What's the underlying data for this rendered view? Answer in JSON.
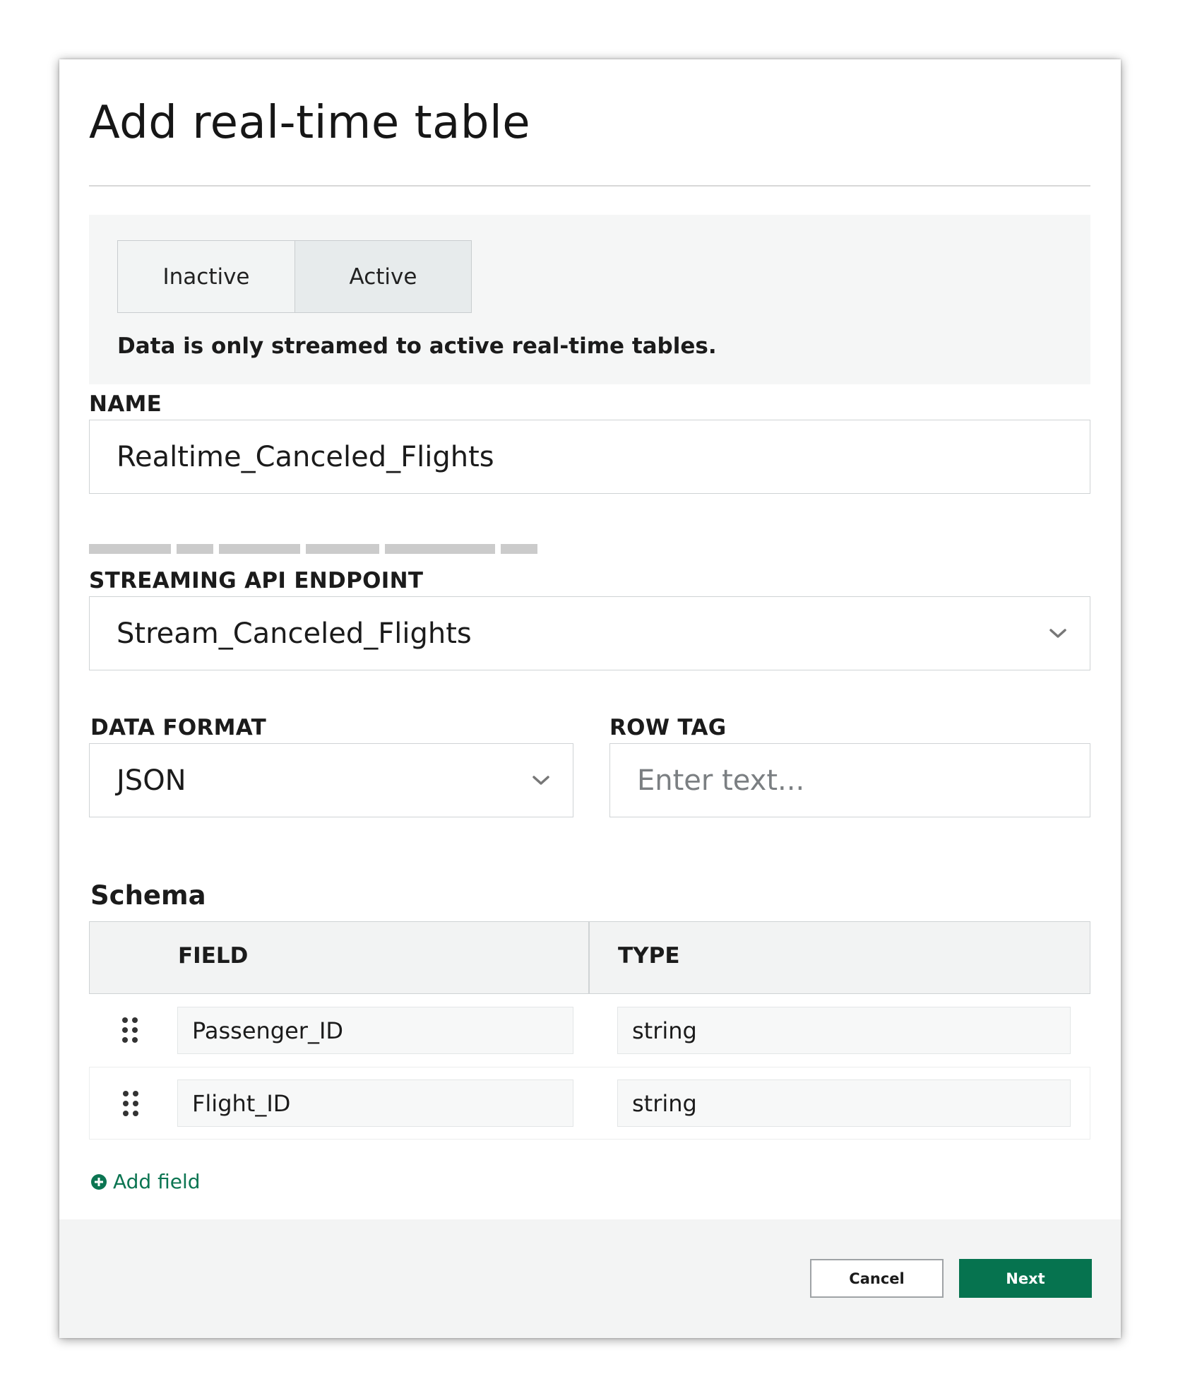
{
  "dialog": {
    "title": "Add real-time table"
  },
  "status": {
    "options": [
      "Inactive",
      "Active"
    ],
    "selected": "Active",
    "note": "Data is only streamed to active real-time tables."
  },
  "name_field": {
    "label": "NAME",
    "value": "Realtime_Canceled_Flights"
  },
  "endpoint_field": {
    "label": "STREAMING API ENDPOINT",
    "value": "Stream_Canceled_Flights",
    "icon": "chevron-down-icon"
  },
  "data_format_field": {
    "label": "DATA FORMAT",
    "value": "JSON",
    "icon": "chevron-down-icon"
  },
  "row_tag_field": {
    "label": "ROW TAG",
    "value": "",
    "placeholder": "Enter text..."
  },
  "schema": {
    "title": "Schema",
    "columns": [
      "FIELD",
      "TYPE"
    ],
    "rows": [
      {
        "field": "Passenger_ID",
        "type": "string"
      },
      {
        "field": "Flight_ID",
        "type": "string"
      }
    ],
    "add_field_label": "Add field",
    "add_icon": "plus-circle-icon",
    "drag_icon": "drag-handle-icon"
  },
  "footer": {
    "cancel_label": "Cancel",
    "next_label": "Next"
  },
  "colors": {
    "accent": "#06734f",
    "link": "#0c7552",
    "panel_bg": "#f5f6f6"
  }
}
